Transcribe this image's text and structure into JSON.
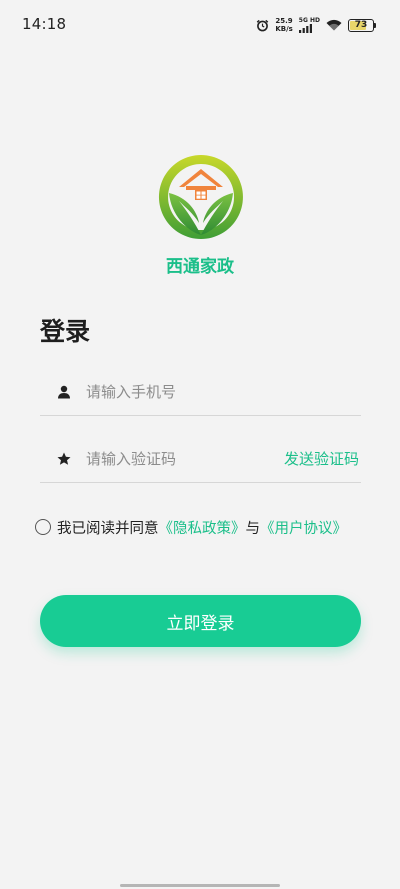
{
  "status_bar": {
    "time": "14:18",
    "net_speed_value": "25.9",
    "net_speed_unit": "KB/s",
    "signal_label": "5G HD",
    "battery": "73",
    "battery_level": 0.73
  },
  "app": {
    "name": "西通家政",
    "logo_icon": "house-leaves-logo-icon"
  },
  "login": {
    "title": "登录",
    "phone_placeholder": "请输入手机号",
    "code_placeholder": "请输入验证码",
    "send_code_label": "发送验证码",
    "agreement_prefix": "我已阅读并同意",
    "privacy_link": "《隐私政策》",
    "and_text": "与",
    "terms_link": "《用户协议》",
    "submit_label": "立即登录"
  },
  "colors": {
    "accent": "#18cc94",
    "link": "#1bbf8a",
    "background": "#f3f3f3",
    "logo_green": "#5cae3a",
    "logo_orange": "#f0843c"
  }
}
